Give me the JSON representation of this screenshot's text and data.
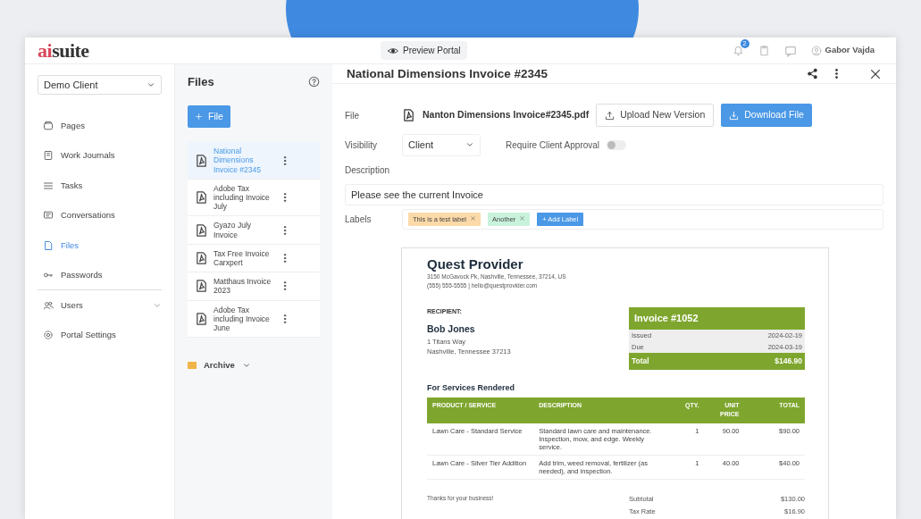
{
  "logo": {
    "accent": "ai",
    "rest": "suite"
  },
  "topbar": {
    "preview_label": "Preview Portal",
    "notification_count": "2",
    "user_name": "Gabor Vajda"
  },
  "sidebar": {
    "client_select": "Demo Client",
    "items": [
      {
        "label": "Pages",
        "selected": false,
        "expandable": false,
        "divider_after": false
      },
      {
        "label": "Work Journals",
        "selected": false,
        "expandable": false,
        "divider_after": false
      },
      {
        "label": "Tasks",
        "selected": false,
        "expandable": false,
        "divider_after": false
      },
      {
        "label": "Conversations",
        "selected": false,
        "expandable": false,
        "divider_after": false
      },
      {
        "label": "Files",
        "selected": true,
        "expandable": false,
        "divider_after": false
      },
      {
        "label": "Passwords",
        "selected": false,
        "expandable": false,
        "divider_after": true
      },
      {
        "label": "Users",
        "selected": false,
        "expandable": true,
        "divider_after": false
      },
      {
        "label": "Portal Settings",
        "selected": false,
        "expandable": false,
        "divider_after": false
      }
    ]
  },
  "files_panel": {
    "title": "Files",
    "add_button": "File",
    "files": [
      {
        "name": "National Dimensions Invoice #2345",
        "selected": true
      },
      {
        "name": "Adobe Tax including Invoice July",
        "selected": false
      },
      {
        "name": "Gyazo July Invoice",
        "selected": false
      },
      {
        "name": "Tax Free Invoice Carxpert",
        "selected": false
      },
      {
        "name": "Matthaus Invoice 2023",
        "selected": false
      },
      {
        "name": "Adobe Tax including Invoice June",
        "selected": false
      }
    ],
    "archive": "Archive"
  },
  "detail": {
    "title": "National Dimensions Invoice #2345",
    "file_label": "File",
    "file_name": "Nanton Dimensions Invoice#2345.pdf",
    "upload_button": "Upload New Version",
    "download_button": "Download File",
    "visibility_label": "Visibility",
    "visibility_value": "Client",
    "approval_label": "Require Client Approval",
    "approval_on": false,
    "description_label": "Description",
    "description_value": "Please see the current Invoice",
    "labels_label": "Labels",
    "labels": [
      {
        "text": "This is a test label",
        "color": "#fcd9a8"
      },
      {
        "text": "Another",
        "color": "#c8f2dc"
      }
    ],
    "add_label": "+ Add Label"
  },
  "invoice": {
    "company": "Quest Provider",
    "address": "3150 McGavock Pk, Nashville, Tennessee, 37214, US",
    "contact": "(555) 555-5555 | hello@questprovider.com",
    "recipient_label": "RECIPIENT:",
    "recipient_name": "Bob Jones",
    "recipient_lines": [
      "1 Titans Way",
      "Nashville, Tennessee 37213"
    ],
    "invoice_title": "Invoice #1052",
    "meta": [
      {
        "label": "Issued",
        "value": "2024-02-19"
      },
      {
        "label": "Due",
        "value": "2024-03-19"
      }
    ],
    "total_label": "Total",
    "total_value": "$146.90",
    "services_title": "For Services Rendered",
    "columns": [
      "PRODUCT / SERVICE",
      "DESCRIPTION",
      "QTY.",
      "UNIT PRICE",
      "TOTAL"
    ],
    "rows": [
      [
        "Lawn Care - Standard Service",
        "Standard lawn care and maintenance. Inspection, mow, and edge. Weekly service.",
        "1",
        "90.00",
        "$90.00"
      ],
      [
        "Lawn Care - Silver Tier Addition",
        "Add trim, weed removal, fertilizer (as needed), and inspection.",
        "1",
        "40.00",
        "$40.00"
      ]
    ],
    "thanks": "Thanks for your business!",
    "summary": [
      {
        "label": "Subtotal",
        "value": "$130.00"
      },
      {
        "label": "Tax Rate",
        "value": "$16.90"
      }
    ]
  }
}
